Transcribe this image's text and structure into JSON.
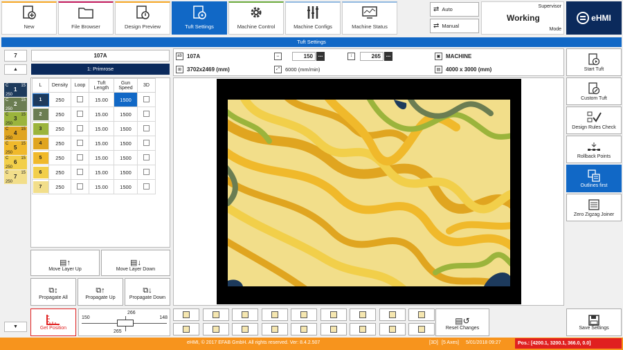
{
  "toolbar": {
    "tabs": [
      {
        "label": "New",
        "icon": "new-icon",
        "color": "#f5a623"
      },
      {
        "label": "File Browser",
        "icon": "folder-icon",
        "color": "#c2185b"
      },
      {
        "label": "Design Preview",
        "icon": "design-preview-icon",
        "color": "#f5a623"
      },
      {
        "label": "Tuft Settings",
        "icon": "tuft-settings-icon",
        "color": "#1168c6"
      },
      {
        "label": "Machine Control",
        "icon": "gear-icon",
        "color": "#6aaa3a"
      },
      {
        "label": "Machine Configs",
        "icon": "tools-icon",
        "color": "#90b8e0"
      },
      {
        "label": "Machine Status",
        "icon": "monitor-icon",
        "color": "#90b8e0"
      }
    ],
    "mode_auto": "Auto",
    "mode_manual": "Manual",
    "user_role": "Supervisor",
    "status": "Working",
    "mode_label": "Mode",
    "logo_text": "eHMI"
  },
  "title_bar": "Tuft Settings",
  "layers_panel": {
    "count": "7",
    "swatches": [
      {
        "c": "C",
        "n": "1",
        "a": "15",
        "b": "250",
        "color": "#1d3a5c",
        "text": "#fff"
      },
      {
        "c": "C",
        "n": "2",
        "a": "15",
        "b": "250",
        "color": "#6b7d52",
        "text": "#fff"
      },
      {
        "c": "C",
        "n": "3",
        "a": "15",
        "b": "250",
        "color": "#9bb43c",
        "text": "#222"
      },
      {
        "c": "C",
        "n": "4",
        "a": "15",
        "b": "250",
        "color": "#e0a520",
        "text": "#222"
      },
      {
        "c": "C",
        "n": "5",
        "a": "15",
        "b": "250",
        "color": "#f0b92b",
        "text": "#222"
      },
      {
        "c": "C",
        "n": "6",
        "a": "15",
        "b": "250",
        "color": "#f2cf4a",
        "text": "#222"
      },
      {
        "c": "C",
        "n": "7",
        "a": "15",
        "b": "250",
        "color": "#f2de8a",
        "text": "#222"
      }
    ]
  },
  "design": {
    "name": "107A",
    "layer_name": "1: Primrose",
    "dims_mm": "3702x2469 (mm)",
    "width_value": "150",
    "height_value": "265",
    "speed": "6000 (mm/min)",
    "machine_label": "MACHINE",
    "machine_size": "4000 x 3000 (mm)",
    "dots_btn": "..."
  },
  "layer_table": {
    "headers": [
      "L",
      "Density",
      "Loop",
      "Tuft Length",
      "Gun Speed",
      "3D"
    ],
    "rows": [
      {
        "l": "1",
        "density": "250",
        "length": "15.00",
        "speed": "1500",
        "color": "#1d3a5c"
      },
      {
        "l": "2",
        "density": "250",
        "length": "15.00",
        "speed": "1500",
        "color": "#6b7d52"
      },
      {
        "l": "3",
        "density": "250",
        "length": "15.00",
        "speed": "1500",
        "color": "#9bb43c"
      },
      {
        "l": "4",
        "density": "250",
        "length": "15.00",
        "speed": "1500",
        "color": "#e0a520"
      },
      {
        "l": "5",
        "density": "250",
        "length": "15.00",
        "speed": "1500",
        "color": "#f0b92b"
      },
      {
        "l": "6",
        "density": "250",
        "length": "15.00",
        "speed": "1500",
        "color": "#f2cf4a"
      },
      {
        "l": "7",
        "density": "250",
        "length": "15.00",
        "speed": "1500",
        "color": "#f2de8a"
      }
    ]
  },
  "actions": {
    "move_up": "Move Layer Up",
    "move_down": "Move Layer Down",
    "propagate_all": "Propagate All",
    "propagate_up": "Propagate Up",
    "propagate_down": "Propagate Down",
    "get_position": "Get Position",
    "reset_changes": "Reset Changes",
    "save_settings": "Save Settings"
  },
  "position_widget": {
    "left": "150",
    "top": "266",
    "right": "148",
    "bottom": "265"
  },
  "side_buttons": [
    {
      "label": "Start Tuft",
      "icon": "start-tuft-icon"
    },
    {
      "label": "Custom Tuft",
      "icon": "custom-tuft-icon"
    },
    {
      "label": "Design Rules Check",
      "icon": "rules-check-icon"
    },
    {
      "label": "Rollback Points",
      "icon": "rollback-icon"
    },
    {
      "label": "Outlines first",
      "icon": "outlines-icon"
    },
    {
      "label": "Zero Zigzag Joiner",
      "icon": "zigzag-icon"
    }
  ],
  "status_bar": {
    "copyright": "eHMI, © 2017 EFAB GmbH. All rights reserved. Ver: 8.4.2.507",
    "mode3d": "[3D]",
    "axes": "[5 Axes]",
    "datetime": "5/01/2018 09:27",
    "pos": "Pos.: [4200.1, 3200.1, 366.0, 0.0]",
    "accent": "#f7941d",
    "pos_color": "#e02020"
  }
}
